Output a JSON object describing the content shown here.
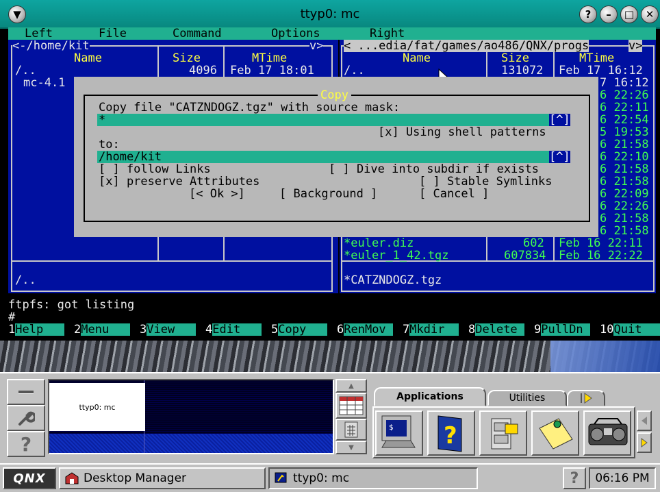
{
  "window": {
    "title": "ttyp0: mc"
  },
  "menubar": [
    "Left",
    "File",
    "Command",
    "Options",
    "Right"
  ],
  "left_panel": {
    "path": "<-/home/kit",
    "path_right": "v>",
    "col_name": "Name",
    "col_size": "Size",
    "col_mtime": "MTime",
    "rows": [
      {
        "name": "/..",
        "size": "4096",
        "mtime": "Feb 17 18:01"
      },
      {
        "name": "mc-4.1",
        "size": "",
        "mtime": ""
      }
    ],
    "footer": "/.."
  },
  "right_panel": {
    "path": "< ...edia/fat/games/ao486/QNX/progs",
    "path_right": "v>",
    "col_name": "Name",
    "col_size": "Size",
    "col_mtime": "MTime",
    "top_row": {
      "name": "/..",
      "size": "131072",
      "mtime": "Feb 17 16:12"
    },
    "times": [
      "7 16:12",
      "6 22:26",
      "6 22:11",
      "6 22:54",
      "5 19:53",
      "6 21:58",
      "6 22:10",
      "6 21:58",
      "6 21:58",
      "6 22:09",
      "6 22:26",
      "6 21:58",
      "6 21:58"
    ],
    "bottom_rows": [
      {
        "name": "*euler.diz",
        "size": "602",
        "mtime": "Feb 16 22:11"
      },
      {
        "name": "*euler_1_42.tgz",
        "size": "607834",
        "mtime": "Feb 16 22:22"
      }
    ],
    "footer": "*CATZNDOGZ.tgz"
  },
  "dialog": {
    "title": "Copy",
    "line1": "Copy file \"CATZNDOGZ.tgz\" with source mask:",
    "mask_value": "*",
    "history_btn": "[^]",
    "shell_patterns": "[x] Using shell patterns",
    "to_label": "to:",
    "dest_value": "/home/kit",
    "follow_links": "[ ] follow Links",
    "dive_subdir": "[ ] Dive into subdir if exists",
    "preserve_attr": "[x] preserve Attributes",
    "stable_symlinks": "[ ] Stable Symlinks",
    "ok_btn": "[< Ok >]",
    "background_btn": "[ Background ]",
    "cancel_btn": "[ Cancel ]"
  },
  "status_line": "ftpfs: got listing",
  "prompt": "#",
  "fkeys": [
    {
      "n": "1",
      "label": "Help"
    },
    {
      "n": "2",
      "label": "Menu"
    },
    {
      "n": "3",
      "label": "View"
    },
    {
      "n": "4",
      "label": "Edit"
    },
    {
      "n": "5",
      "label": "Copy"
    },
    {
      "n": "6",
      "label": "RenMov"
    },
    {
      "n": "7",
      "label": "Mkdir"
    },
    {
      "n": "8",
      "label": "Delete"
    },
    {
      "n": "9",
      "label": "PullDn"
    },
    {
      "n": "10",
      "label": "Quit"
    }
  ],
  "shelf": {
    "pager_thumb_label": "ttyp0: mc",
    "tabs": {
      "applications": "Applications",
      "utilities": "Utilities"
    }
  },
  "taskbar": {
    "logo": "QNX",
    "desktop_manager": "Desktop Manager",
    "task_ttyp0": "ttyp0: mc",
    "clock": "06:16 PM",
    "help_glyph": "?"
  },
  "colors": {
    "teal": "#20b090",
    "mc_blue": "#0010a0",
    "yellow": "#ffff40",
    "green": "#40ff50"
  }
}
